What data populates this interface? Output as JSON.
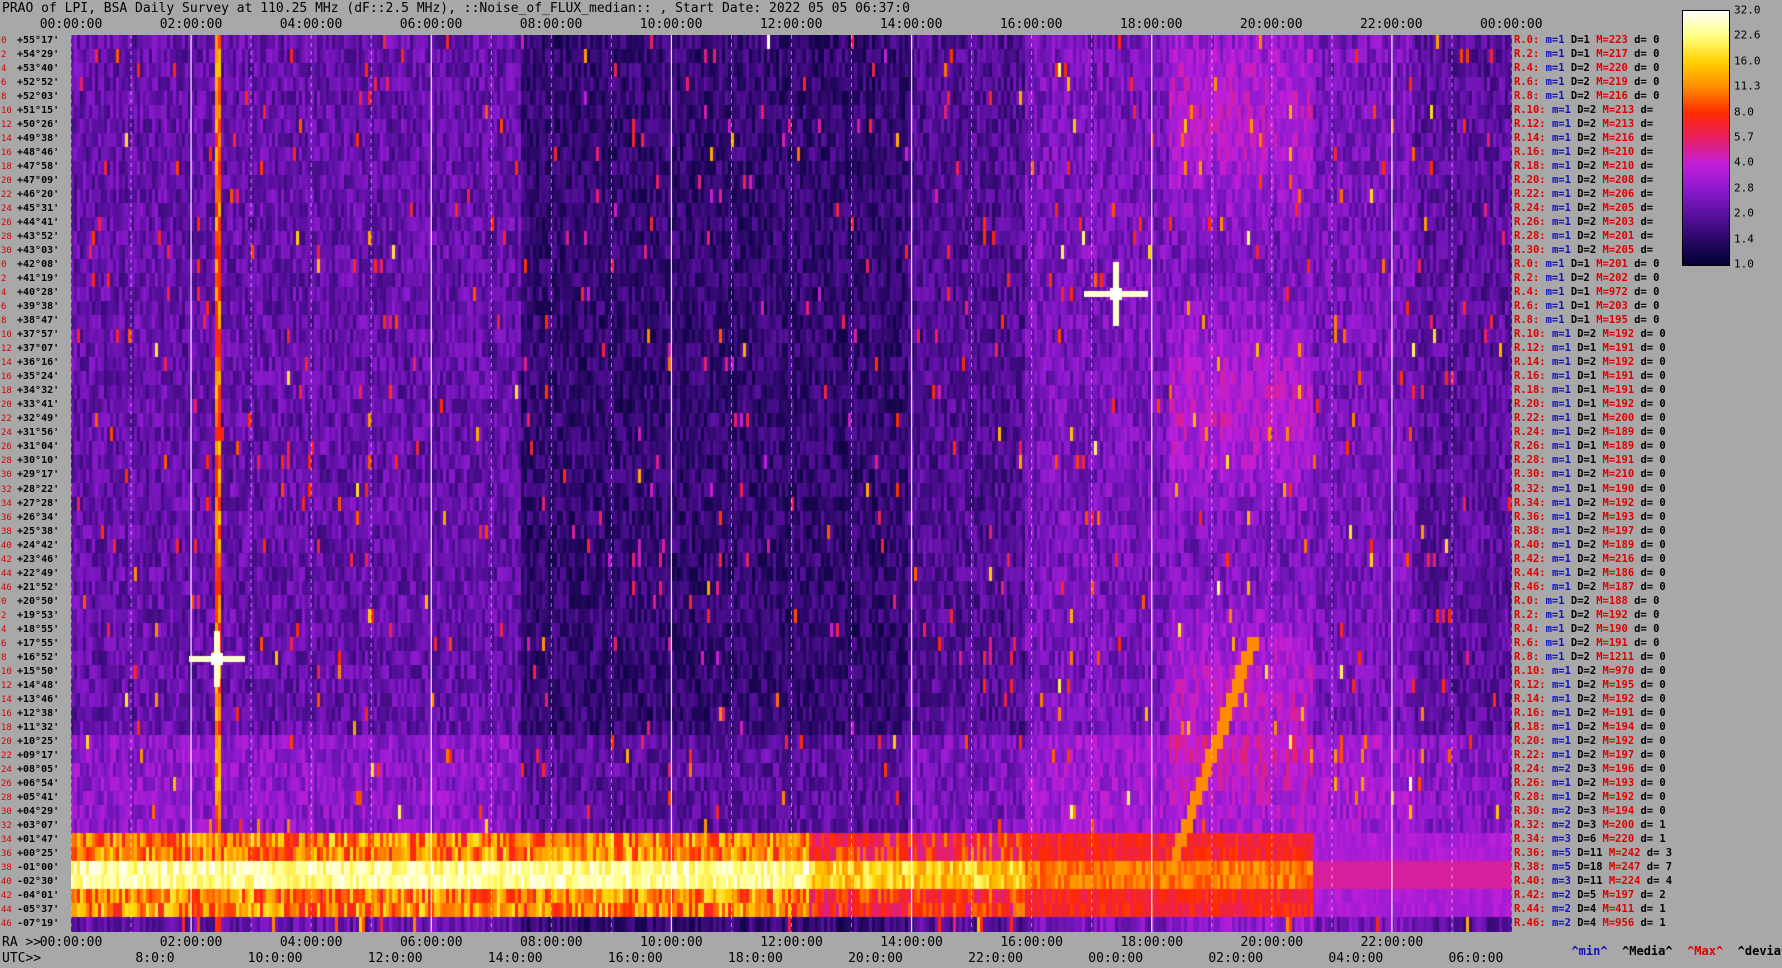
{
  "title": "PRAO of LPI, BSA Daily Survey at 110.25 MHz (dF::2.5 MHz), ::Noise_of_FLUX_median:: , Start Date: 2022 05 05 06:37:0",
  "chart_data": {
    "type": "heatmap",
    "title": "PRAO of LPI, BSA Daily Survey at 110.25 MHz (dF::2.5 MHz), ::Noise_of_FLUX_median:: , Start Date: 2022 05 05 06:37:0",
    "top_axis_ticks": [
      "00:00:00",
      "02:00:00",
      "04:00:00",
      "06:00:00",
      "08:00:00",
      "10:00:00",
      "12:00:00",
      "14:00:00",
      "16:00:00",
      "18:00:00",
      "20:00:00",
      "22:00:00",
      "00:00:00"
    ],
    "ra_axis_label": "RA >>",
    "ra_axis_ticks": [
      "00:00:00",
      "02:00:00",
      "04:00:00",
      "06:00:00",
      "08:00:00",
      "10:00:00",
      "12:00:00",
      "14:00:00",
      "16:00:00",
      "18:00:00",
      "20:00:00",
      "22:00:00",
      "00:00:00",
      "02:00:00",
      "04:00:00",
      "06:00:00"
    ],
    "utc_axis_label": "UTC>>",
    "utc_axis_ticks": [
      "8:0:0",
      "10:0:00",
      "12:0:00",
      "14:0:00",
      "16:0:00",
      "18:0:00",
      "20:0:00",
      "22:0:00",
      "00:0:00",
      "02:0:00",
      "04:0:00",
      "06:0:00"
    ],
    "declinations": [
      "+55°17'",
      "+54°29'",
      "+53°40'",
      "+52°52'",
      "+52°03'",
      "+51°15'",
      "+50°26'",
      "+49°38'",
      "+48°46'",
      "+47°58'",
      "+47°09'",
      "+46°20'",
      "+45°31'",
      "+44°41'",
      "+43°52'",
      "+43°03'",
      "+42°08'",
      "+41°19'",
      "+40°28'",
      "+39°38'",
      "+38°47'",
      "+37°57'",
      "+37°07'",
      "+36°16'",
      "+35°24'",
      "+34°32'",
      "+33°41'",
      "+32°49'",
      "+31°56'",
      "+31°04'",
      "+30°10'",
      "+29°17'",
      "+28°22'",
      "+27°28'",
      "+26°34'",
      "+25°38'",
      "+24°42'",
      "+23°46'",
      "+22°49'",
      "+21°52'",
      "+20°50'",
      "+19°53'",
      "+18°55'",
      "+17°55'",
      "+16°52'",
      "+15°50'",
      "+14°48'",
      "+13°46'",
      "+12°38'",
      "+11°32'",
      "+10°25'",
      "+09°17'",
      "+08°05'",
      "+06°54'",
      "+05°41'",
      "+04°29'",
      "+03°07'",
      "+01°47'",
      "+00°25'",
      "-01°00'",
      "-02°30'",
      "-04°01'",
      "-05°37'",
      "-07°19'"
    ],
    "row_index": [
      "0",
      "2",
      "4",
      "6",
      "8",
      "10",
      "12",
      "14",
      "16",
      "18",
      "20",
      "22",
      "24",
      "26",
      "28",
      "30",
      "0",
      "2",
      "4",
      "6",
      "8",
      "10",
      "12",
      "14",
      "16",
      "18",
      "20",
      "22",
      "24",
      "26",
      "28",
      "30",
      "32",
      "34",
      "36",
      "38",
      "40",
      "42",
      "44",
      "46",
      "0",
      "2",
      "4",
      "6",
      "8",
      "10",
      "12",
      "14",
      "16",
      "18",
      "20",
      "22",
      "24",
      "26",
      "28",
      "30",
      "32",
      "34",
      "36",
      "38",
      "40",
      "42",
      "44",
      "46"
    ],
    "row_stats": [
      {
        "r": "R.0:",
        "m": "m=1",
        "D": "D=1",
        "M": "M=223",
        "d": "d= 0"
      },
      {
        "r": "R.2:",
        "m": "m=1",
        "D": "D=1",
        "M": "M=217",
        "d": "d= 0"
      },
      {
        "r": "R.4:",
        "m": "m=1",
        "D": "D=2",
        "M": "M=220",
        "d": "d= 0"
      },
      {
        "r": "R.6:",
        "m": "m=1",
        "D": "D=2",
        "M": "M=219",
        "d": "d= 0"
      },
      {
        "r": "R.8:",
        "m": "m=1",
        "D": "D=2",
        "M": "M=216",
        "d": "d= 0"
      },
      {
        "r": "R.10:",
        "m": "m=1",
        "D": "D=2",
        "M": "M=213",
        "d": "d="
      },
      {
        "r": "R.12:",
        "m": "m=1",
        "D": "D=2",
        "M": "M=213",
        "d": "d="
      },
      {
        "r": "R.14:",
        "m": "m=1",
        "D": "D=2",
        "M": "M=216",
        "d": "d="
      },
      {
        "r": "R.16:",
        "m": "m=1",
        "D": "D=2",
        "M": "M=210",
        "d": "d="
      },
      {
        "r": "R.18:",
        "m": "m=1",
        "D": "D=2",
        "M": "M=210",
        "d": "d="
      },
      {
        "r": "R.20:",
        "m": "m=1",
        "D": "D=2",
        "M": "M=208",
        "d": "d="
      },
      {
        "r": "R.22:",
        "m": "m=1",
        "D": "D=2",
        "M": "M=206",
        "d": "d="
      },
      {
        "r": "R.24:",
        "m": "m=1",
        "D": "D=2",
        "M": "M=205",
        "d": "d="
      },
      {
        "r": "R.26:",
        "m": "m=1",
        "D": "D=2",
        "M": "M=203",
        "d": "d="
      },
      {
        "r": "R.28:",
        "m": "m=1",
        "D": "D=2",
        "M": "M=201",
        "d": "d="
      },
      {
        "r": "R.30:",
        "m": "m=1",
        "D": "D=2",
        "M": "M=205",
        "d": "d="
      },
      {
        "r": "R.0:",
        "m": "m=1",
        "D": "D=1",
        "M": "M=201",
        "d": "d= 0"
      },
      {
        "r": "R.2:",
        "m": "m=1",
        "D": "D=2",
        "M": "M=202",
        "d": "d= 0"
      },
      {
        "r": "R.4:",
        "m": "m=1",
        "D": "D=1",
        "M": "M=972",
        "d": "d= 0"
      },
      {
        "r": "R.6:",
        "m": "m=1",
        "D": "D=1",
        "M": "M=203",
        "d": "d= 0"
      },
      {
        "r": "R.8:",
        "m": "m=1",
        "D": "D=1",
        "M": "M=195",
        "d": "d= 0"
      },
      {
        "r": "R.10:",
        "m": "m=1",
        "D": "D=2",
        "M": "M=192",
        "d": "d= 0"
      },
      {
        "r": "R.12:",
        "m": "m=1",
        "D": "D=1",
        "M": "M=191",
        "d": "d= 0"
      },
      {
        "r": "R.14:",
        "m": "m=1",
        "D": "D=2",
        "M": "M=192",
        "d": "d= 0"
      },
      {
        "r": "R.16:",
        "m": "m=1",
        "D": "D=1",
        "M": "M=191",
        "d": "d= 0"
      },
      {
        "r": "R.18:",
        "m": "m=1",
        "D": "D=1",
        "M": "M=191",
        "d": "d= 0"
      },
      {
        "r": "R.20:",
        "m": "m=1",
        "D": "D=1",
        "M": "M=192",
        "d": "d= 0"
      },
      {
        "r": "R.22:",
        "m": "m=1",
        "D": "D=1",
        "M": "M=200",
        "d": "d= 0"
      },
      {
        "r": "R.24:",
        "m": "m=1",
        "D": "D=2",
        "M": "M=189",
        "d": "d= 0"
      },
      {
        "r": "R.26:",
        "m": "m=1",
        "D": "D=1",
        "M": "M=189",
        "d": "d= 0"
      },
      {
        "r": "R.28:",
        "m": "m=1",
        "D": "D=1",
        "M": "M=191",
        "d": "d= 0"
      },
      {
        "r": "R.30:",
        "m": "m=1",
        "D": "D=2",
        "M": "M=210",
        "d": "d= 0"
      },
      {
        "r": "R.32:",
        "m": "m=1",
        "D": "D=1",
        "M": "M=190",
        "d": "d= 0"
      },
      {
        "r": "R.34:",
        "m": "m=1",
        "D": "D=2",
        "M": "M=192",
        "d": "d= 0"
      },
      {
        "r": "R.36:",
        "m": "m=1",
        "D": "D=2",
        "M": "M=193",
        "d": "d= 0"
      },
      {
        "r": "R.38:",
        "m": "m=1",
        "D": "D=2",
        "M": "M=197",
        "d": "d= 0"
      },
      {
        "r": "R.40:",
        "m": "m=1",
        "D": "D=2",
        "M": "M=189",
        "d": "d= 0"
      },
      {
        "r": "R.42:",
        "m": "m=1",
        "D": "D=2",
        "M": "M=216",
        "d": "d= 0"
      },
      {
        "r": "R.44:",
        "m": "m=1",
        "D": "D=2",
        "M": "M=186",
        "d": "d= 0"
      },
      {
        "r": "R.46:",
        "m": "m=1",
        "D": "D=2",
        "M": "M=187",
        "d": "d= 0"
      },
      {
        "r": "R.0:",
        "m": "m=1",
        "D": "D=2",
        "M": "M=188",
        "d": "d= 0"
      },
      {
        "r": "R.2:",
        "m": "m=1",
        "D": "D=2",
        "M": "M=192",
        "d": "d= 0"
      },
      {
        "r": "R.4:",
        "m": "m=1",
        "D": "D=2",
        "M": "M=190",
        "d": "d= 0"
      },
      {
        "r": "R.6:",
        "m": "m=1",
        "D": "D=2",
        "M": "M=191",
        "d": "d= 0"
      },
      {
        "r": "R.8:",
        "m": "m=1",
        "D": "D=2",
        "M": "M=1211",
        "d": "d= 0"
      },
      {
        "r": "R.10:",
        "m": "m=1",
        "D": "D=2",
        "M": "M=970",
        "d": "d= 0"
      },
      {
        "r": "R.12:",
        "m": "m=1",
        "D": "D=2",
        "M": "M=195",
        "d": "d= 0"
      },
      {
        "r": "R.14:",
        "m": "m=1",
        "D": "D=2",
        "M": "M=192",
        "d": "d= 0"
      },
      {
        "r": "R.16:",
        "m": "m=1",
        "D": "D=2",
        "M": "M=191",
        "d": "d= 0"
      },
      {
        "r": "R.18:",
        "m": "m=1",
        "D": "D=2",
        "M": "M=194",
        "d": "d= 0"
      },
      {
        "r": "R.20:",
        "m": "m=1",
        "D": "D=2",
        "M": "M=192",
        "d": "d= 0"
      },
      {
        "r": "R.22:",
        "m": "m=1",
        "D": "D=2",
        "M": "M=197",
        "d": "d= 0"
      },
      {
        "r": "R.24:",
        "m": "m=2",
        "D": "D=3",
        "M": "M=196",
        "d": "d= 0"
      },
      {
        "r": "R.26:",
        "m": "m=1",
        "D": "D=2",
        "M": "M=193",
        "d": "d= 0"
      },
      {
        "r": "R.28:",
        "m": "m=1",
        "D": "D=2",
        "M": "M=192",
        "d": "d= 0"
      },
      {
        "r": "R.30:",
        "m": "m=2",
        "D": "D=3",
        "M": "M=194",
        "d": "d= 0"
      },
      {
        "r": "R.32:",
        "m": "m=2",
        "D": "D=3",
        "M": "M=200",
        "d": "d= 1"
      },
      {
        "r": "R.34:",
        "m": "m=3",
        "D": "D=6",
        "M": "M=220",
        "d": "d= 1"
      },
      {
        "r": "R.36:",
        "m": "m=5",
        "D": "D=11",
        "M": "M=242",
        "d": "d= 3"
      },
      {
        "r": "R.38:",
        "m": "m=5",
        "D": "D=18",
        "M": "M=247",
        "d": "d= 7"
      },
      {
        "r": "R.40:",
        "m": "m=3",
        "D": "D=11",
        "M": "M=224",
        "d": "d= 4"
      },
      {
        "r": "R.42:",
        "m": "m=2",
        "D": "D=5",
        "M": "M=197",
        "d": "d= 2"
      },
      {
        "r": "R.44:",
        "m": "m=2",
        "D": "D=4",
        "M": "M=411",
        "d": "d= 1"
      },
      {
        "r": "R.46:",
        "m": "m=2",
        "D": "D=4",
        "M": "M=956",
        "d": "d= 1"
      }
    ],
    "colorbar_ticks": [
      "32.0",
      "22.6",
      "16.0",
      "11.3",
      "8.0",
      "5.7",
      "4.0",
      "2.8",
      "2.0",
      "1.4",
      "1.0"
    ],
    "colorbar_scale": "log",
    "colorbar_range": [
      1.0,
      32.0
    ],
    "colormap": [
      "#000033",
      "#2a0866",
      "#5a10a0",
      "#8e1ad0",
      "#c21fd8",
      "#e81f60",
      "#ff2a00",
      "#ff8c00",
      "#ffd000",
      "#ffff80",
      "#ffffff"
    ],
    "legend_labels": {
      "min": "^min^",
      "media": "^Media^",
      "max": "^Max^",
      "devia": "^devia^"
    },
    "bright_sources_RA_hours": [
      3.3,
      20.0
    ],
    "bright_sources_dec": [
      "+16°52'",
      "+40°28'"
    ]
  }
}
